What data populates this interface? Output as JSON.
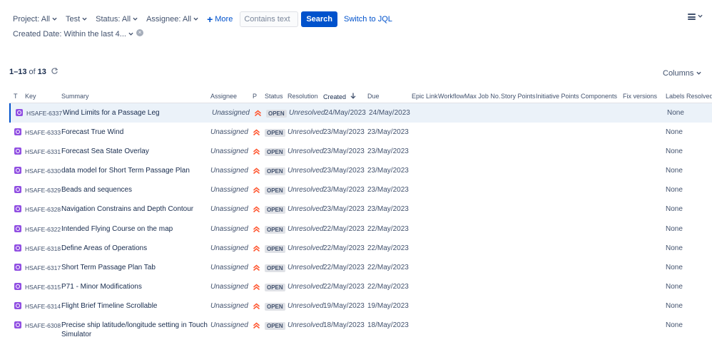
{
  "filters": {
    "project": "Project: All",
    "test": "Test",
    "status": "Status: All",
    "assignee": "Assignee: All",
    "more": "More",
    "text_placeholder": "Contains text",
    "search_label": "Search",
    "switch_jql": "Switch to JQL",
    "created_date": "Created Date: Within the last 4..."
  },
  "results": {
    "range": "1–13",
    "of": "of",
    "total": "13"
  },
  "columns_button": "Columns",
  "table": {
    "headers": {
      "type": "T",
      "key": "Key",
      "summary": "Summary",
      "assignee": "Assignee",
      "priority": "P",
      "status": "Status",
      "resolution": "Resolution",
      "created": "Created",
      "due": "Due",
      "epic_link": "Epic Link",
      "workflowmax": "WorkflowMax Job No.",
      "story_points": "Story Points",
      "initiative_points": "Initiative Points",
      "components": "Components",
      "fix_versions": "Fix versions",
      "labels": "Labels",
      "resolved": "Resolved"
    },
    "rows": [
      {
        "key": "HSAFE-6337",
        "summary": "Wind Limits for a Passage Leg",
        "assignee": "Unassigned",
        "status": "OPEN",
        "resolution": "Unresolved",
        "created": "24/May/2023",
        "due": "24/May/2023",
        "labels": "None"
      },
      {
        "key": "HSAFE-6333",
        "summary": "Forecast True Wind",
        "assignee": "Unassigned",
        "status": "OPEN",
        "resolution": "Unresolved",
        "created": "23/May/2023",
        "due": "23/May/2023",
        "labels": "None"
      },
      {
        "key": "HSAFE-6331",
        "summary": "Forecast Sea State Overlay",
        "assignee": "Unassigned",
        "status": "OPEN",
        "resolution": "Unresolved",
        "created": "23/May/2023",
        "due": "23/May/2023",
        "labels": "None"
      },
      {
        "key": "HSAFE-6330",
        "summary": "data model for Short Term Passage Plan",
        "assignee": "Unassigned",
        "status": "OPEN",
        "resolution": "Unresolved",
        "created": "23/May/2023",
        "due": "23/May/2023",
        "labels": "None"
      },
      {
        "key": "HSAFE-6329",
        "summary": "Beads and sequences",
        "assignee": "Unassigned",
        "status": "OPEN",
        "resolution": "Unresolved",
        "created": "23/May/2023",
        "due": "23/May/2023",
        "labels": "None"
      },
      {
        "key": "HSAFE-6328",
        "summary": "Navigation Constrains and Depth Contour",
        "assignee": "Unassigned",
        "status": "OPEN",
        "resolution": "Unresolved",
        "created": "23/May/2023",
        "due": "23/May/2023",
        "labels": "None"
      },
      {
        "key": "HSAFE-6322",
        "summary": "Intended Flying Course on the map",
        "assignee": "Unassigned",
        "status": "OPEN",
        "resolution": "Unresolved",
        "created": "22/May/2023",
        "due": "22/May/2023",
        "labels": "None"
      },
      {
        "key": "HSAFE-6318",
        "summary": "Define Areas of Operations",
        "assignee": "Unassigned",
        "status": "OPEN",
        "resolution": "Unresolved",
        "created": "22/May/2023",
        "due": "22/May/2023",
        "labels": "None"
      },
      {
        "key": "HSAFE-6317",
        "summary": "Short Term Passage Plan Tab",
        "assignee": "Unassigned",
        "status": "OPEN",
        "resolution": "Unresolved",
        "created": "22/May/2023",
        "due": "22/May/2023",
        "labels": "None"
      },
      {
        "key": "HSAFE-6315",
        "summary": "P71 - Minor Modifications",
        "assignee": "Unassigned",
        "status": "OPEN",
        "resolution": "Unresolved",
        "created": "22/May/2023",
        "due": "22/May/2023",
        "labels": "None"
      },
      {
        "key": "HSAFE-6314",
        "summary": "Flight Brief Timeline Scrollable",
        "assignee": "Unassigned",
        "status": "OPEN",
        "resolution": "Unresolved",
        "created": "19/May/2023",
        "due": "19/May/2023",
        "labels": "None"
      },
      {
        "key": "HSAFE-6308",
        "summary": "Precise ship latitude/longitude setting in Touch Simulator",
        "assignee": "Unassigned",
        "status": "OPEN",
        "resolution": "Unresolved",
        "created": "18/May/2023",
        "due": "18/May/2023",
        "labels": "None"
      }
    ]
  },
  "icons": {
    "issue_type": "story-icon",
    "priority": "priority-highest-icon",
    "sort": "sort-descending-icon",
    "refresh": "refresh-icon",
    "menu": "hamburger-icon",
    "clear": "clear-filter-icon"
  },
  "colors": {
    "accent": "#0052cc",
    "issue_type": "#904ee2",
    "priority": "#ff5630",
    "selected_row": "#ebf2f9"
  }
}
